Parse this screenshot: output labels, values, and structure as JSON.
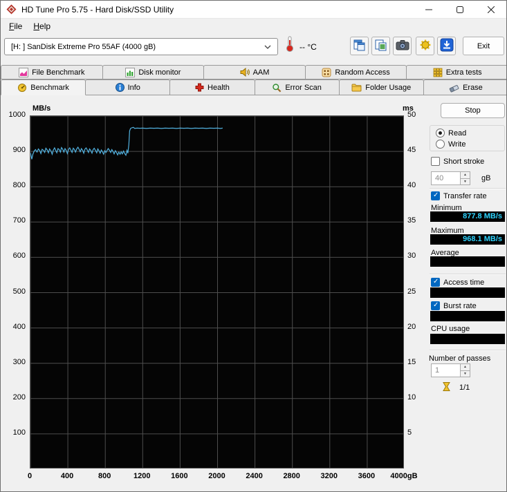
{
  "titlebar": {
    "title": "HD Tune Pro 5.75 - Hard Disk/SSD Utility"
  },
  "menubar": {
    "items": [
      "File",
      "Help"
    ]
  },
  "toolbar": {
    "drive_select": "[H: ] SanDisk Extreme Pro 55AF (4000 gB)",
    "temperature": "-- °C",
    "exit_label": "Exit"
  },
  "tabs_row1": [
    {
      "label": "File Benchmark"
    },
    {
      "label": "Disk monitor"
    },
    {
      "label": "AAM"
    },
    {
      "label": "Random Access"
    },
    {
      "label": "Extra tests"
    }
  ],
  "tabs_row2": [
    {
      "label": "Benchmark",
      "active": true
    },
    {
      "label": "Info"
    },
    {
      "label": "Health"
    },
    {
      "label": "Error Scan"
    },
    {
      "label": "Folder Usage"
    },
    {
      "label": "Erase"
    }
  ],
  "chart_data": {
    "type": "line",
    "title": "",
    "ylabel_left": "MB/s",
    "ylabel_right": "ms",
    "x_max": 4000,
    "y_left_max": 1000,
    "y_right_max": 50,
    "grid": true,
    "grid_color": "#4e4e4e",
    "plot_bg": "#050505",
    "x_tick_values": [
      0,
      400,
      800,
      1200,
      1600,
      2000,
      2400,
      2800,
      3200,
      3600,
      4000
    ],
    "x_tick_labels": [
      "0",
      "400",
      "800",
      "1200",
      "1600",
      "2000",
      "2400",
      "2800",
      "3200",
      "3600",
      "4000gB"
    ],
    "y_left_tick_values": [
      100,
      200,
      300,
      400,
      500,
      600,
      700,
      800,
      900,
      1000
    ],
    "y_left_tick_labels": [
      "100",
      "200",
      "300",
      "400",
      "500",
      "600",
      "700",
      "800",
      "900",
      "1000"
    ],
    "y_right_tick_labels": [
      "5",
      "10",
      "15",
      "20",
      "25",
      "30",
      "35",
      "40",
      "45",
      "50"
    ],
    "series": [
      {
        "name": "transfer-rate",
        "unit": "MB/s",
        "color": "#52b2e0",
        "points": [
          [
            0,
            896
          ],
          [
            8,
            886
          ],
          [
            15,
            877.8
          ],
          [
            25,
            891
          ],
          [
            40,
            901
          ],
          [
            55,
            905
          ],
          [
            70,
            898
          ],
          [
            85,
            907
          ],
          [
            100,
            902
          ],
          [
            112,
            894
          ],
          [
            125,
            906
          ],
          [
            140,
            903
          ],
          [
            152,
            897
          ],
          [
            165,
            909
          ],
          [
            180,
            904
          ],
          [
            192,
            896
          ],
          [
            205,
            907
          ],
          [
            220,
            901
          ],
          [
            232,
            892
          ],
          [
            245,
            904
          ],
          [
            258,
            910
          ],
          [
            270,
            903
          ],
          [
            282,
            896
          ],
          [
            295,
            908
          ],
          [
            308,
            905
          ],
          [
            320,
            898
          ],
          [
            332,
            911
          ],
          [
            345,
            906
          ],
          [
            358,
            898
          ],
          [
            370,
            908
          ],
          [
            382,
            903
          ],
          [
            395,
            894
          ],
          [
            408,
            906
          ],
          [
            420,
            910
          ],
          [
            432,
            904
          ],
          [
            445,
            897
          ],
          [
            458,
            909
          ],
          [
            470,
            905
          ],
          [
            482,
            898
          ],
          [
            495,
            907
          ],
          [
            508,
            912
          ],
          [
            520,
            906
          ],
          [
            532,
            899
          ],
          [
            545,
            908
          ],
          [
            558,
            903
          ],
          [
            570,
            895
          ],
          [
            582,
            906
          ],
          [
            595,
            910
          ],
          [
            608,
            904
          ],
          [
            620,
            897
          ],
          [
            632,
            907
          ],
          [
            645,
            903
          ],
          [
            658,
            895
          ],
          [
            670,
            905
          ],
          [
            682,
            909
          ],
          [
            695,
            903
          ],
          [
            708,
            896
          ],
          [
            720,
            907
          ],
          [
            732,
            902
          ],
          [
            745,
            895
          ],
          [
            758,
            904
          ],
          [
            770,
            899
          ],
          [
            782,
            892
          ],
          [
            795,
            902
          ],
          [
            808,
            897
          ],
          [
            820,
            903
          ],
          [
            832,
            908
          ],
          [
            845,
            903
          ],
          [
            858,
            897
          ],
          [
            870,
            905
          ],
          [
            882,
            900
          ],
          [
            895,
            893
          ],
          [
            908,
            902
          ],
          [
            920,
            897
          ],
          [
            932,
            890
          ],
          [
            945,
            898
          ],
          [
            958,
            892
          ],
          [
            970,
            899
          ],
          [
            982,
            893
          ],
          [
            995,
            901
          ],
          [
            1008,
            894
          ],
          [
            1020,
            889
          ],
          [
            1032,
            903
          ],
          [
            1042,
            895
          ],
          [
            1052,
            920
          ],
          [
            1060,
            958
          ],
          [
            1070,
            965
          ],
          [
            1085,
            967
          ],
          [
            1100,
            968.1
          ],
          [
            1115,
            965
          ],
          [
            1140,
            966
          ],
          [
            1170,
            965.5
          ],
          [
            1200,
            966
          ],
          [
            1240,
            965
          ],
          [
            1280,
            966
          ],
          [
            1320,
            965.5
          ],
          [
            1360,
            966
          ],
          [
            1400,
            965
          ],
          [
            1440,
            966
          ],
          [
            1480,
            965.5
          ],
          [
            1520,
            966
          ],
          [
            1560,
            965
          ],
          [
            1600,
            966
          ],
          [
            1640,
            965.5
          ],
          [
            1680,
            966
          ],
          [
            1720,
            965
          ],
          [
            1760,
            966
          ],
          [
            1800,
            965.5
          ],
          [
            1840,
            966
          ],
          [
            1880,
            965
          ],
          [
            1920,
            966
          ],
          [
            1960,
            965.5
          ],
          [
            2000,
            966
          ],
          [
            2030,
            965
          ],
          [
            2055,
            966
          ]
        ]
      }
    ]
  },
  "panel": {
    "stop_label": "Stop",
    "read_label": "Read",
    "write_label": "Write",
    "read_checked": true,
    "write_checked": false,
    "short_stroke_label": "Short stroke",
    "short_stroke_checked": false,
    "short_stroke_value": "40",
    "short_stroke_unit": "gB",
    "transfer_rate_label": "Transfer rate",
    "transfer_rate_checked": true,
    "minimum_label": "Minimum",
    "minimum_value": "877.8 MB/s",
    "maximum_label": "Maximum",
    "maximum_value": "968.1 MB/s",
    "average_label": "Average",
    "average_value": "",
    "access_time_label": "Access time",
    "access_time_checked": true,
    "access_time_value": "",
    "burst_rate_label": "Burst rate",
    "burst_rate_checked": true,
    "burst_rate_value": "",
    "cpu_usage_label": "CPU usage",
    "cpu_usage_value": "",
    "passes_label": "Number of passes",
    "passes_value": "1",
    "progress_text": "1/1"
  }
}
